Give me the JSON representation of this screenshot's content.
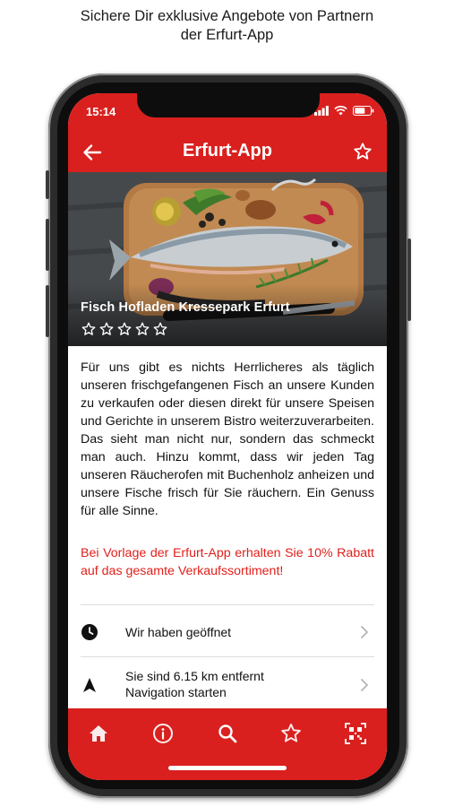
{
  "caption": {
    "line1": "Sichere Dir exklusive Angebote von Partnern",
    "line2": "der Erfurt-App"
  },
  "status": {
    "time": "15:14"
  },
  "appbar": {
    "title": "Erfurt-App"
  },
  "hero": {
    "title": "Fisch Hofladen Kressepark Erfurt",
    "rating_stars_filled": 0,
    "rating_stars_total": 5
  },
  "description": "Für uns gibt es nichts Herrlicheres als täglich unseren frischgefangenen Fisch an unsere Kunden zu verkaufen oder diesen direkt für unsere Speisen und Gerichte in unserem Bistro weiterzuverarbeiten. Das sieht man nicht nur, sondern das schmeckt man auch. Hinzu kommt, dass wir jeden Tag unseren Räucherofen mit Buchenholz anheizen und unsere Fische frisch für Sie räuchern. Ein Genuss für alle Sinne.",
  "promo": "Bei Vorlage der Erfurt-App erhalten Sie 10% Rabatt auf das gesamte Verkaufssortiment!",
  "info_rows": [
    {
      "icon": "clock-icon",
      "text": "Wir haben geöffnet"
    },
    {
      "icon": "navigation-icon",
      "line1": "Sie sind 6.15 km entfernt",
      "line2": "Navigation starten"
    }
  ],
  "tabs": [
    "home-icon",
    "info-icon",
    "search-icon",
    "star-icon",
    "qr-code-icon"
  ],
  "colors": {
    "accent": "#d9201e",
    "promo_text": "#e0201b",
    "text": "#111111"
  }
}
